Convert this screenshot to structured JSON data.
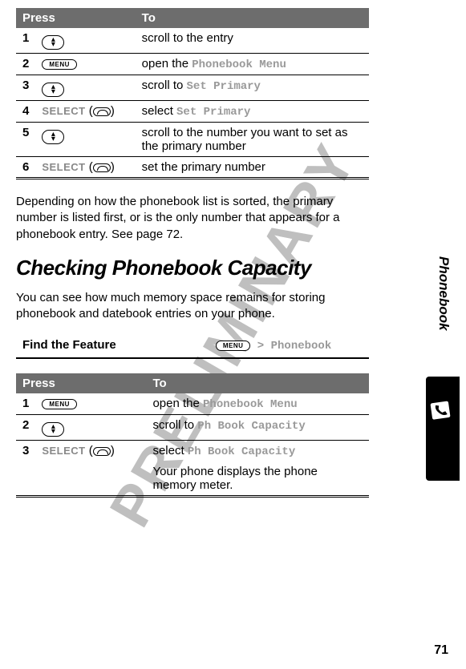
{
  "watermark": "PRELIMINARY",
  "sideTab": "Phonebook",
  "pageNum": "71",
  "table1": {
    "headPress": "Press",
    "headTo": "To",
    "rows": [
      {
        "n": "1",
        "press_type": "scroll",
        "to": "scroll to the entry"
      },
      {
        "n": "2",
        "press_type": "menu",
        "to_prefix": "open the ",
        "to_menu": "Phonebook Menu"
      },
      {
        "n": "3",
        "press_type": "scroll",
        "to_prefix": "scroll to ",
        "to_menu": "Set Primary"
      },
      {
        "n": "4",
        "press_type": "select",
        "select_label": "SELECT",
        "to_prefix": "select ",
        "to_menu": "Set Primary"
      },
      {
        "n": "5",
        "press_type": "scroll",
        "to": "scroll to the number you want to set as the primary number"
      },
      {
        "n": "6",
        "press_type": "select",
        "select_label": "SELECT",
        "to": "set the primary number"
      }
    ]
  },
  "para1": "Depending on how the phonebook list is sorted, the primary number is listed first, or is the only number that appears for a phonebook entry. See page 72.",
  "heading": "Checking Phonebook Capacity",
  "para2": "You can see how much memory space remains for storing phonebook and datebook entries on your phone.",
  "findFeature": "Find the Feature",
  "findPath_sep": " > ",
  "findPath_menu": "Phonebook",
  "table2": {
    "headPress": "Press",
    "headTo": "To",
    "rows": [
      {
        "n": "1",
        "press_type": "menu",
        "to_prefix": "open the ",
        "to_menu": "Phonebook Menu"
      },
      {
        "n": "2",
        "press_type": "scroll",
        "to_prefix": "scroll to ",
        "to_menu": "Ph Book Capacity"
      },
      {
        "n": "3",
        "press_type": "select",
        "select_label": "SELECT",
        "to_prefix": "select ",
        "to_menu": "Ph Book Capacity",
        "to_extra": "Your phone displays the phone memory meter."
      }
    ]
  },
  "menuBtn": "MENU"
}
